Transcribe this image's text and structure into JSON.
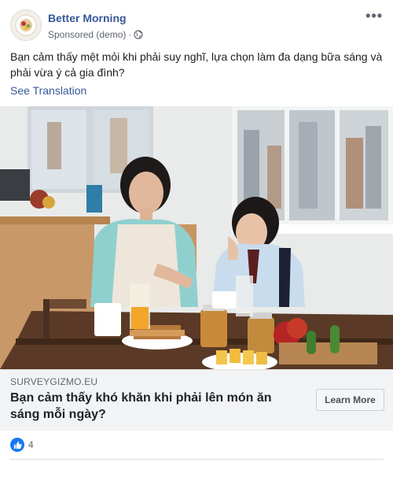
{
  "post": {
    "page_name": "Better Morning",
    "sponsored_label": "Sponsored (demo)",
    "separator": "·",
    "more_label": "•••",
    "text": "Bạn cảm thấy mệt mỏi khi phải suy nghĩ, lựa chọn làm đa dạng bữa sáng và phải vừa ý cả gia đình?",
    "see_translation": "See Translation"
  },
  "link": {
    "domain": "SURVEYGIZMO.EU",
    "title": "Bạn cảm thấy khó khăn khi phải lên món ăn sáng mỗi ngày?",
    "cta": "Learn More"
  },
  "reactions": {
    "icon": "like-icon",
    "count": "4"
  },
  "colors": {
    "brand_blue": "#385898",
    "like_blue": "#1877f2",
    "link_bar_bg": "#f2f3f5"
  }
}
